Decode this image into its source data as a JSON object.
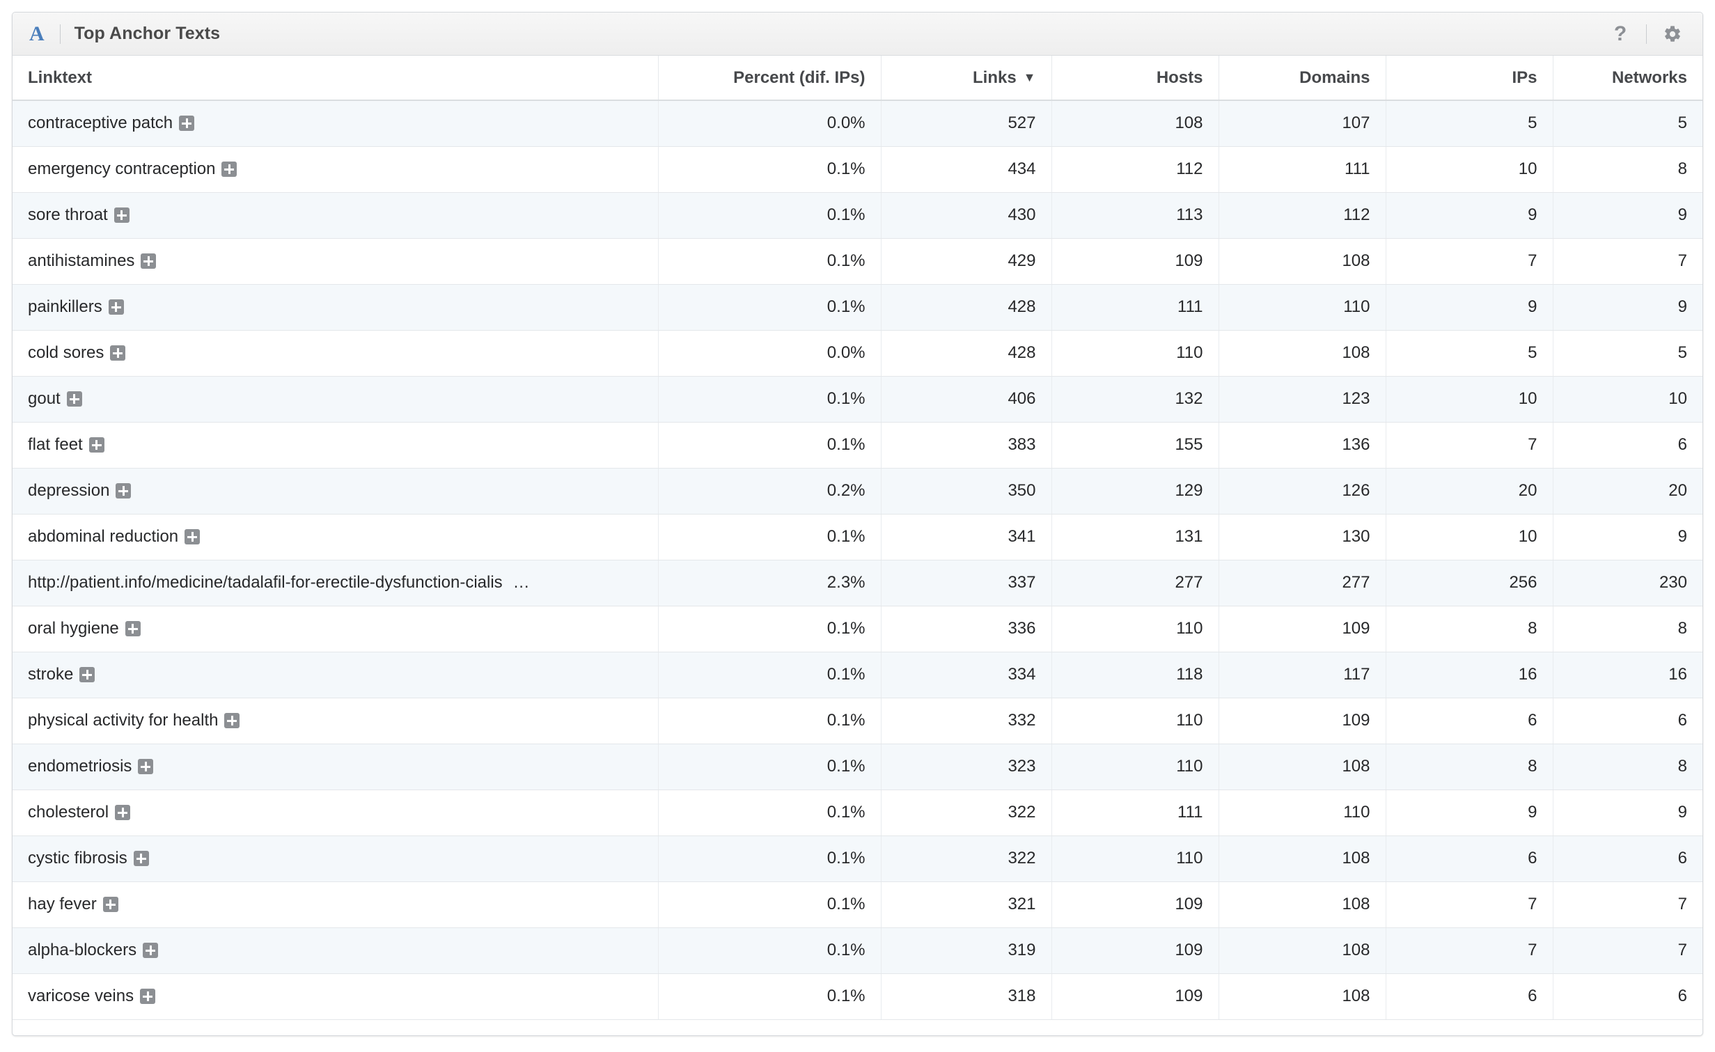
{
  "panel": {
    "badge_letter": "A",
    "title": "Top Anchor Texts",
    "help_icon": "question-mark-icon",
    "settings_icon": "gear-icon",
    "accent_color": "#4a7ebb"
  },
  "table": {
    "columns": [
      {
        "key": "linktext",
        "label": "Linktext",
        "align": "left",
        "sorted": false
      },
      {
        "key": "percent",
        "label": "Percent (dif. IPs)",
        "align": "right",
        "sorted": false
      },
      {
        "key": "links",
        "label": "Links",
        "align": "right",
        "sorted": true,
        "sort_direction": "desc",
        "sort_caret": "▼"
      },
      {
        "key": "hosts",
        "label": "Hosts",
        "align": "right",
        "sorted": false
      },
      {
        "key": "domains",
        "label": "Domains",
        "align": "right",
        "sorted": false
      },
      {
        "key": "ips",
        "label": "IPs",
        "align": "right",
        "sorted": false
      },
      {
        "key": "networks",
        "label": "Networks",
        "align": "right",
        "sorted": false
      }
    ],
    "expand_icon": "plus-icon",
    "truncation_marker": "…",
    "rows": [
      {
        "linktext": "contraceptive patch",
        "expandable": true,
        "truncated": false,
        "percent": "0.0%",
        "links": "527",
        "hosts": "108",
        "domains": "107",
        "ips": "5",
        "networks": "5"
      },
      {
        "linktext": "emergency contraception",
        "expandable": true,
        "truncated": false,
        "percent": "0.1%",
        "links": "434",
        "hosts": "112",
        "domains": "111",
        "ips": "10",
        "networks": "8"
      },
      {
        "linktext": "sore throat",
        "expandable": true,
        "truncated": false,
        "percent": "0.1%",
        "links": "430",
        "hosts": "113",
        "domains": "112",
        "ips": "9",
        "networks": "9"
      },
      {
        "linktext": "antihistamines",
        "expandable": true,
        "truncated": false,
        "percent": "0.1%",
        "links": "429",
        "hosts": "109",
        "domains": "108",
        "ips": "7",
        "networks": "7"
      },
      {
        "linktext": "painkillers",
        "expandable": true,
        "truncated": false,
        "percent": "0.1%",
        "links": "428",
        "hosts": "111",
        "domains": "110",
        "ips": "9",
        "networks": "9"
      },
      {
        "linktext": "cold sores",
        "expandable": true,
        "truncated": false,
        "percent": "0.0%",
        "links": "428",
        "hosts": "110",
        "domains": "108",
        "ips": "5",
        "networks": "5"
      },
      {
        "linktext": "gout",
        "expandable": true,
        "truncated": false,
        "percent": "0.1%",
        "links": "406",
        "hosts": "132",
        "domains": "123",
        "ips": "10",
        "networks": "10"
      },
      {
        "linktext": "flat feet",
        "expandable": true,
        "truncated": false,
        "percent": "0.1%",
        "links": "383",
        "hosts": "155",
        "domains": "136",
        "ips": "7",
        "networks": "6"
      },
      {
        "linktext": "depression",
        "expandable": true,
        "truncated": false,
        "percent": "0.2%",
        "links": "350",
        "hosts": "129",
        "domains": "126",
        "ips": "20",
        "networks": "20"
      },
      {
        "linktext": "abdominal reduction",
        "expandable": true,
        "truncated": false,
        "percent": "0.1%",
        "links": "341",
        "hosts": "131",
        "domains": "130",
        "ips": "10",
        "networks": "9"
      },
      {
        "linktext": "http://patient.info/medicine/tadalafil-for-erectile-dysfunction-cialis",
        "expandable": false,
        "truncated": true,
        "percent": "2.3%",
        "links": "337",
        "hosts": "277",
        "domains": "277",
        "ips": "256",
        "networks": "230"
      },
      {
        "linktext": "oral hygiene",
        "expandable": true,
        "truncated": false,
        "percent": "0.1%",
        "links": "336",
        "hosts": "110",
        "domains": "109",
        "ips": "8",
        "networks": "8"
      },
      {
        "linktext": "stroke",
        "expandable": true,
        "truncated": false,
        "percent": "0.1%",
        "links": "334",
        "hosts": "118",
        "domains": "117",
        "ips": "16",
        "networks": "16"
      },
      {
        "linktext": "physical activity for health",
        "expandable": true,
        "truncated": false,
        "percent": "0.1%",
        "links": "332",
        "hosts": "110",
        "domains": "109",
        "ips": "6",
        "networks": "6"
      },
      {
        "linktext": "endometriosis",
        "expandable": true,
        "truncated": false,
        "percent": "0.1%",
        "links": "323",
        "hosts": "110",
        "domains": "108",
        "ips": "8",
        "networks": "8"
      },
      {
        "linktext": "cholesterol",
        "expandable": true,
        "truncated": false,
        "percent": "0.1%",
        "links": "322",
        "hosts": "111",
        "domains": "110",
        "ips": "9",
        "networks": "9"
      },
      {
        "linktext": "cystic fibrosis",
        "expandable": true,
        "truncated": false,
        "percent": "0.1%",
        "links": "322",
        "hosts": "110",
        "domains": "108",
        "ips": "6",
        "networks": "6"
      },
      {
        "linktext": "hay fever",
        "expandable": true,
        "truncated": false,
        "percent": "0.1%",
        "links": "321",
        "hosts": "109",
        "domains": "108",
        "ips": "7",
        "networks": "7"
      },
      {
        "linktext": "alpha-blockers",
        "expandable": true,
        "truncated": false,
        "percent": "0.1%",
        "links": "319",
        "hosts": "109",
        "domains": "108",
        "ips": "7",
        "networks": "7"
      },
      {
        "linktext": "varicose veins",
        "expandable": true,
        "truncated": false,
        "percent": "0.1%",
        "links": "318",
        "hosts": "109",
        "domains": "108",
        "ips": "6",
        "networks": "6"
      }
    ]
  }
}
